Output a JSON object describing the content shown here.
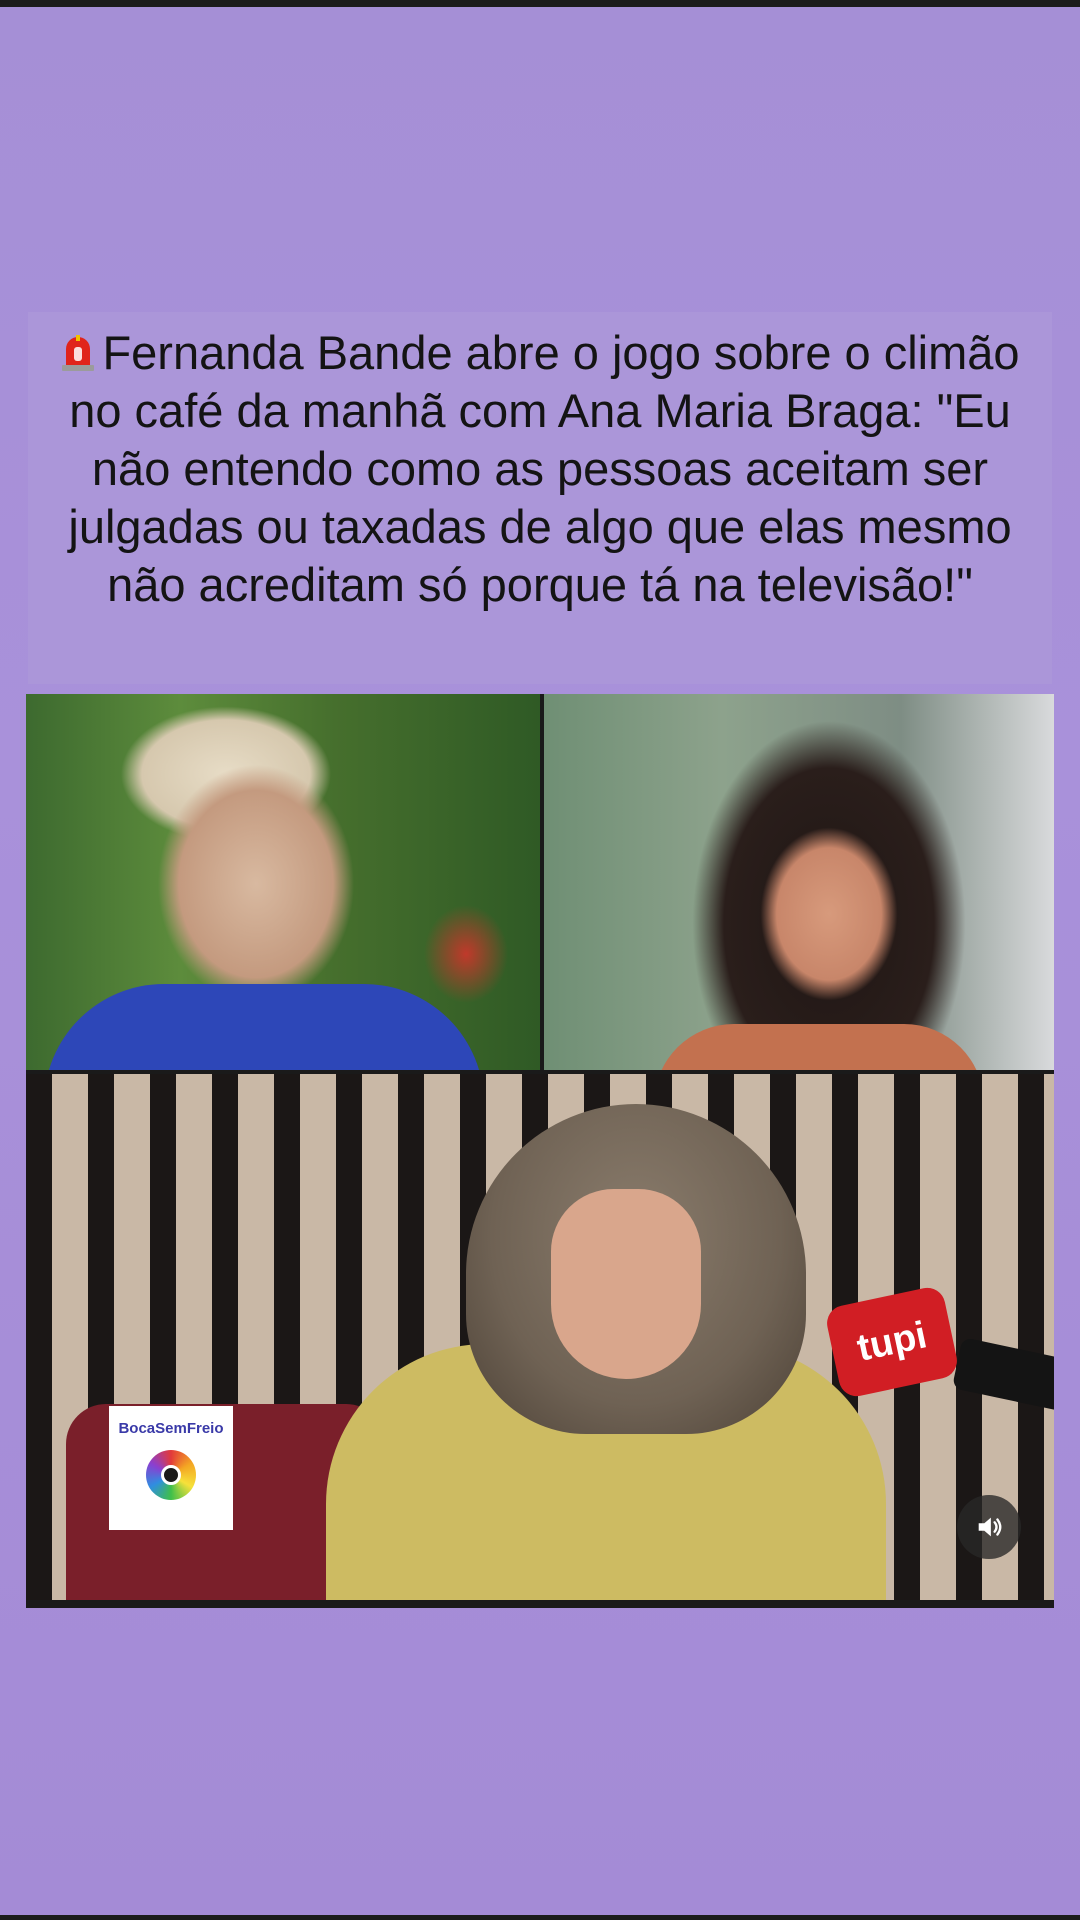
{
  "post": {
    "headline": "Fernanda Bande abre o jogo sobre o climão no café da manhã com Ana Maria Braga: \"Eu não entendo como as pessoas aceitam ser julgadas ou taxadas de algo que elas mesmo não acreditam só porque tá na televisão!\"",
    "headline_icon": "siren-icon"
  },
  "video": {
    "mic_flag_text": "tupi",
    "watermark": {
      "name": "BocaSemFreio",
      "icon": "camera-icon"
    },
    "sound_button": {
      "icon": "speaker-icon",
      "state": "sound on"
    }
  },
  "colors": {
    "background": "#a58fd6",
    "caption_box": "#ab96d9",
    "text": "#141414",
    "siren": "#e0241b"
  }
}
